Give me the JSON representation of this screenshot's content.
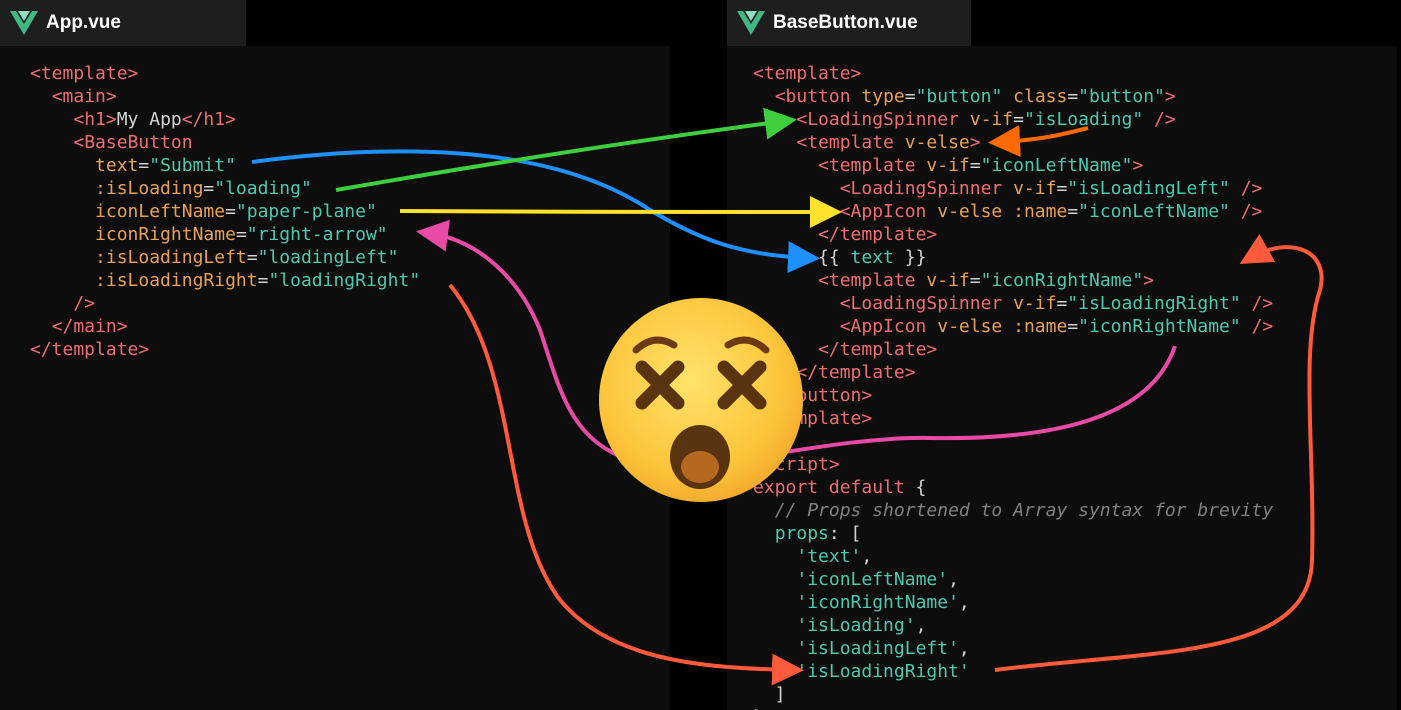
{
  "tabs": [
    {
      "label": "App.vue"
    },
    {
      "label": "BaseButton.vue"
    }
  ],
  "colors": {
    "vue_light": "#41b883",
    "vue_dark": "#35495e",
    "arrow_blue": "#1e90ff",
    "arrow_green": "#3ecf3e",
    "arrow_yellow": "#ffe22e",
    "arrow_pink": "#e84aa6",
    "arrow_red": "#ff5a3c",
    "arrow_orange": "#ff6a00"
  },
  "app_code": [
    [
      [
        "t",
        "<template>"
      ]
    ],
    [
      [
        "p",
        "  "
      ],
      [
        "t",
        "<main>"
      ]
    ],
    [
      [
        "p",
        "    "
      ],
      [
        "t",
        "<h1>"
      ],
      [
        "p",
        "My App"
      ],
      [
        "t",
        "</h1>"
      ]
    ],
    [
      [
        "p",
        "    "
      ],
      [
        "t",
        "<BaseButton"
      ]
    ],
    [
      [
        "p",
        "      "
      ],
      [
        "a",
        "text"
      ],
      [
        "p",
        "="
      ],
      [
        "s",
        "\"Submit\""
      ]
    ],
    [
      [
        "p",
        "      "
      ],
      [
        "a",
        ":isLoading"
      ],
      [
        "p",
        "="
      ],
      [
        "s",
        "\"loading\""
      ]
    ],
    [
      [
        "p",
        "      "
      ],
      [
        "a",
        "iconLeftName"
      ],
      [
        "p",
        "="
      ],
      [
        "s",
        "\"paper-plane\""
      ]
    ],
    [
      [
        "p",
        "      "
      ],
      [
        "a",
        "iconRightName"
      ],
      [
        "p",
        "="
      ],
      [
        "s",
        "\"right-arrow\""
      ]
    ],
    [
      [
        "p",
        "      "
      ],
      [
        "a",
        ":isLoadingLeft"
      ],
      [
        "p",
        "="
      ],
      [
        "s",
        "\"loadingLeft\""
      ]
    ],
    [
      [
        "p",
        "      "
      ],
      [
        "a",
        ":isLoadingRight"
      ],
      [
        "p",
        "="
      ],
      [
        "s",
        "\"loadingRight\""
      ]
    ],
    [
      [
        "p",
        "    "
      ],
      [
        "t",
        "/>"
      ]
    ],
    [
      [
        "p",
        "  "
      ],
      [
        "t",
        "</main>"
      ]
    ],
    [
      [
        "t",
        "</template>"
      ]
    ]
  ],
  "button_code": [
    [
      [
        "t",
        "<template>"
      ]
    ],
    [
      [
        "p",
        "  "
      ],
      [
        "t",
        "<button "
      ],
      [
        "a",
        "type"
      ],
      [
        "p",
        "="
      ],
      [
        "s",
        "\"button\""
      ],
      [
        "p",
        " "
      ],
      [
        "a",
        "class"
      ],
      [
        "p",
        "="
      ],
      [
        "s",
        "\"button\""
      ],
      [
        "t",
        ">"
      ]
    ],
    [
      [
        "p",
        "    "
      ],
      [
        "t",
        "<LoadingSpinner "
      ],
      [
        "a",
        "v-if"
      ],
      [
        "p",
        "="
      ],
      [
        "s",
        "\"isLoading\""
      ],
      [
        "p",
        " "
      ],
      [
        "t",
        "/>"
      ]
    ],
    [
      [
        "p",
        "    "
      ],
      [
        "t",
        "<template "
      ],
      [
        "a",
        "v-else"
      ],
      [
        "t",
        ">"
      ]
    ],
    [
      [
        "p",
        "      "
      ],
      [
        "t",
        "<template "
      ],
      [
        "a",
        "v-if"
      ],
      [
        "p",
        "="
      ],
      [
        "s",
        "\"iconLeftName\""
      ],
      [
        "t",
        ">"
      ]
    ],
    [
      [
        "p",
        "        "
      ],
      [
        "t",
        "<LoadingSpinner "
      ],
      [
        "a",
        "v-if"
      ],
      [
        "p",
        "="
      ],
      [
        "s",
        "\"isLoadingLeft\""
      ],
      [
        "p",
        " "
      ],
      [
        "t",
        "/>"
      ]
    ],
    [
      [
        "p",
        "        "
      ],
      [
        "t",
        "<AppIcon "
      ],
      [
        "a",
        "v-else"
      ],
      [
        "p",
        " "
      ],
      [
        "a",
        ":name"
      ],
      [
        "p",
        "="
      ],
      [
        "s",
        "\"iconLeftName\""
      ],
      [
        "p",
        " "
      ],
      [
        "t",
        "/>"
      ]
    ],
    [
      [
        "p",
        "      "
      ],
      [
        "t",
        "</template>"
      ]
    ],
    [
      [
        "p",
        "      {{ "
      ],
      [
        "s",
        "text"
      ],
      [
        "p",
        " }}"
      ]
    ],
    [
      [
        "p",
        "      "
      ],
      [
        "t",
        "<template "
      ],
      [
        "a",
        "v-if"
      ],
      [
        "p",
        "="
      ],
      [
        "s",
        "\"iconRightName\""
      ],
      [
        "t",
        ">"
      ]
    ],
    [
      [
        "p",
        "        "
      ],
      [
        "t",
        "<LoadingSpinner "
      ],
      [
        "a",
        "v-if"
      ],
      [
        "p",
        "="
      ],
      [
        "s",
        "\"isLoadingRight\""
      ],
      [
        "p",
        " "
      ],
      [
        "t",
        "/>"
      ]
    ],
    [
      [
        "p",
        "        "
      ],
      [
        "t",
        "<AppIcon "
      ],
      [
        "a",
        "v-else"
      ],
      [
        "p",
        " "
      ],
      [
        "a",
        ":name"
      ],
      [
        "p",
        "="
      ],
      [
        "s",
        "\"iconRightName\""
      ],
      [
        "p",
        " "
      ],
      [
        "t",
        "/>"
      ]
    ],
    [
      [
        "p",
        "      "
      ],
      [
        "t",
        "</template>"
      ]
    ],
    [
      [
        "p",
        "    "
      ],
      [
        "t",
        "</template>"
      ]
    ],
    [
      [
        "p",
        "  "
      ],
      [
        "t",
        "</button>"
      ]
    ],
    [
      [
        "t",
        "</template>"
      ]
    ],
    [
      [
        "p",
        ""
      ]
    ],
    [
      [
        "t",
        "<script>"
      ]
    ],
    [
      [
        "k",
        "export default"
      ],
      [
        "p",
        " {"
      ]
    ],
    [
      [
        "p",
        "  "
      ],
      [
        "c",
        "// Props shortened to Array syntax for brevity"
      ]
    ],
    [
      [
        "p",
        "  "
      ],
      [
        "s",
        "props"
      ],
      [
        "p",
        ": ["
      ]
    ],
    [
      [
        "p",
        "    "
      ],
      [
        "s",
        "'text'"
      ],
      [
        "p",
        ","
      ]
    ],
    [
      [
        "p",
        "    "
      ],
      [
        "s",
        "'iconLeftName'"
      ],
      [
        "p",
        ","
      ]
    ],
    [
      [
        "p",
        "    "
      ],
      [
        "s",
        "'iconRightName'"
      ],
      [
        "p",
        ","
      ]
    ],
    [
      [
        "p",
        "    "
      ],
      [
        "s",
        "'isLoading'"
      ],
      [
        "p",
        ","
      ]
    ],
    [
      [
        "p",
        "    "
      ],
      [
        "s",
        "'isLoadingLeft'"
      ],
      [
        "p",
        ","
      ]
    ],
    [
      [
        "p",
        "    "
      ],
      [
        "s",
        "'isLoadingRight'"
      ]
    ],
    [
      [
        "p",
        "  ]"
      ]
    ],
    [
      [
        "p",
        "}"
      ]
    ]
  ],
  "emoji": {
    "icon": "dizzy-face-emoji"
  }
}
